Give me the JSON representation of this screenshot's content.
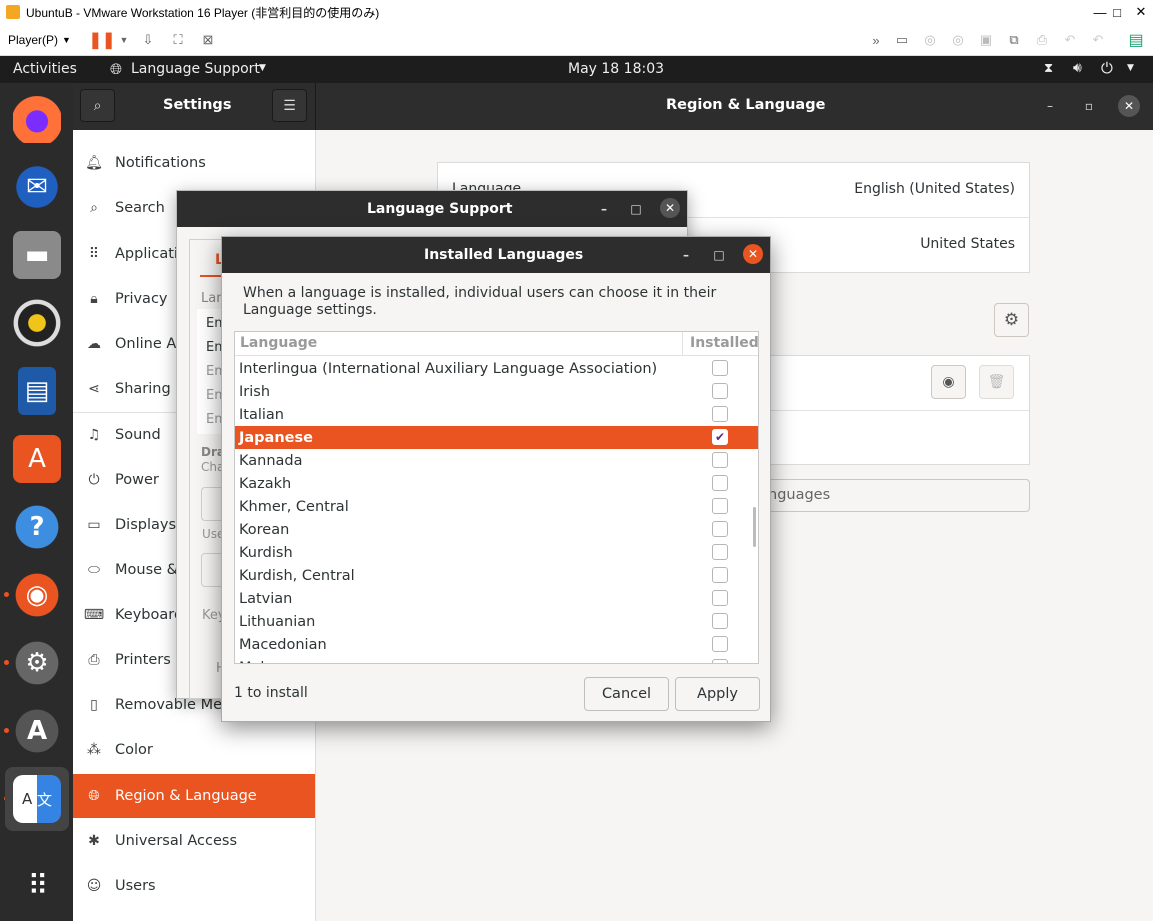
{
  "vm": {
    "title": "UbuntuB - VMware Workstation 16 Player (非営利目的の使用のみ)",
    "player_menu": "Player(P)",
    "min": "—",
    "max": "□",
    "close": "✕"
  },
  "topbar": {
    "activities": "Activities",
    "app_menu": "Language Support",
    "clock": "May 18  18:03"
  },
  "settings": {
    "title": "Settings",
    "panel_title": "Region & Language",
    "sidebar": [
      {
        "label": "Notifications",
        "icon": "bell-icon"
      },
      {
        "label": "Search",
        "icon": "search-icon"
      },
      {
        "label": "Applications",
        "icon": "grid-icon"
      },
      {
        "label": "Privacy",
        "icon": "lock-icon"
      },
      {
        "label": "Online Accounts",
        "icon": "cloud-icon"
      },
      {
        "label": "Sharing",
        "icon": "share-icon"
      },
      {
        "label": "Sound",
        "icon": "music-icon"
      },
      {
        "label": "Power",
        "icon": "power-icon"
      },
      {
        "label": "Displays",
        "icon": "display-icon"
      },
      {
        "label": "Mouse & Touchpad",
        "icon": "mouse-icon"
      },
      {
        "label": "Keyboard Shortcuts",
        "icon": "keyboard-icon"
      },
      {
        "label": "Printers",
        "icon": "printer-icon"
      },
      {
        "label": "Removable Media",
        "icon": "media-icon"
      },
      {
        "label": "Color",
        "icon": "color-icon"
      },
      {
        "label": "Region & Language",
        "icon": "globe-icon"
      },
      {
        "label": "Universal Access",
        "icon": "accessibility-icon"
      },
      {
        "label": "Users",
        "icon": "users-icon"
      }
    ],
    "language_label": "Language",
    "language_value": "English (United States)",
    "formats_value": "United States",
    "manage_languages_partial": "nguages"
  },
  "language_support": {
    "title": "Language Support",
    "tab_partial": "L",
    "lang_label_partial": "Lan",
    "list_partial": [
      "En",
      "En",
      "En",
      "En",
      "En"
    ],
    "drag_partial": "Dra",
    "cha_partial": "Cha",
    "use_partial": "Use",
    "key_partial": "Key",
    "help_partial": "H"
  },
  "installed_languages": {
    "title": "Installed Languages",
    "description": "When a language is installed, individual users can choose it in their Language settings.",
    "col_language": "Language",
    "col_installed": "Installed",
    "rows": [
      {
        "name": "Interlingua (International Auxiliary Language Association)",
        "checked": false
      },
      {
        "name": "Irish",
        "checked": false
      },
      {
        "name": "Italian",
        "checked": false
      },
      {
        "name": "Japanese",
        "checked": true,
        "selected": true
      },
      {
        "name": "Kannada",
        "checked": false
      },
      {
        "name": "Kazakh",
        "checked": false
      },
      {
        "name": "Khmer, Central",
        "checked": false
      },
      {
        "name": "Korean",
        "checked": false
      },
      {
        "name": "Kurdish",
        "checked": false
      },
      {
        "name": "Kurdish, Central",
        "checked": false
      },
      {
        "name": "Latvian",
        "checked": false
      },
      {
        "name": "Lithuanian",
        "checked": false
      },
      {
        "name": "Macedonian",
        "checked": false
      },
      {
        "name": "Malagasy",
        "checked": false
      }
    ],
    "status": "1 to install",
    "cancel": "Cancel",
    "apply": "Apply"
  },
  "colors": {
    "accent": "#e95420",
    "header": "#2d2d2d",
    "dock": "#2b2b2b"
  }
}
